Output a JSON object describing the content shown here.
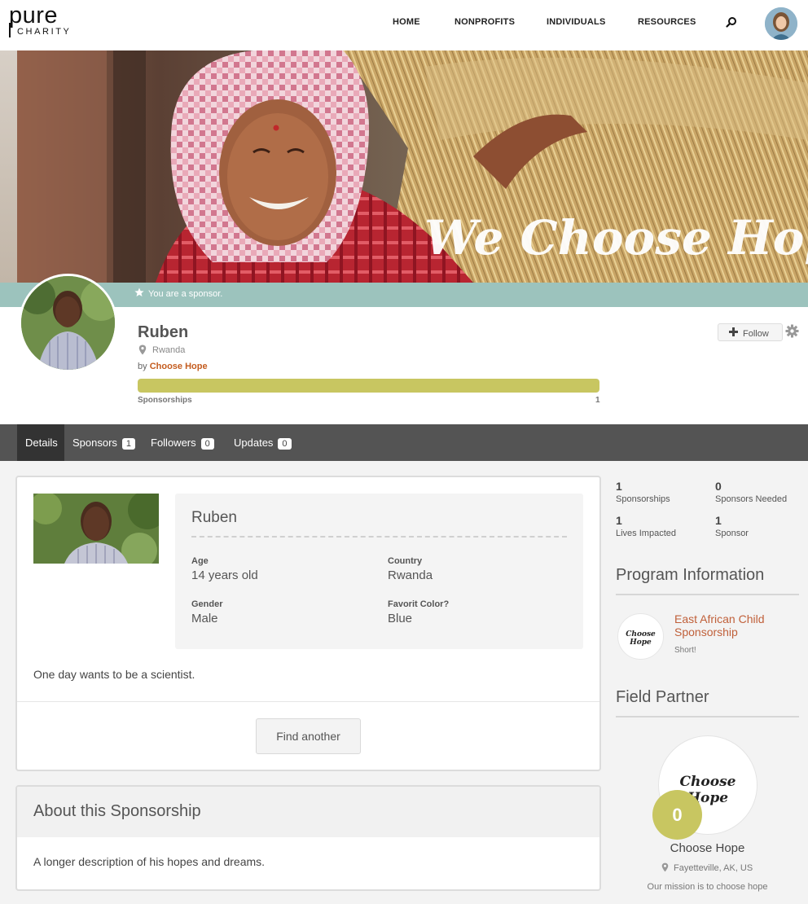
{
  "logo": {
    "line1": "pure",
    "line2": "CHARITY"
  },
  "nav": {
    "links": [
      "HOME",
      "NONPROFITS",
      "INDIVIDUALS",
      "RESOURCES"
    ],
    "search_icon": "search-icon",
    "avatar_icon": "user-avatar"
  },
  "banner": {
    "script_text": "We Choose Hope",
    "sponsor_message": "You are a sponsor."
  },
  "profile": {
    "name": "Ruben",
    "location": "Rwanda",
    "by_prefix": "by",
    "organization": "Choose Hope",
    "progress_fraction": 1.0,
    "progress_label": "Sponsorships",
    "progress_count": "1",
    "follow_label": "Follow"
  },
  "tabs": [
    {
      "label": "Details",
      "badge": ""
    },
    {
      "label": "Sponsors",
      "badge": "1"
    },
    {
      "label": "Followers",
      "badge": "0"
    },
    {
      "label": "Updates",
      "badge": "0"
    }
  ],
  "details": {
    "name": "Ruben",
    "fields": [
      {
        "label": "Age",
        "value": "14 years old"
      },
      {
        "label": "Country",
        "value": "Rwanda"
      },
      {
        "label": "Gender",
        "value": "Male"
      },
      {
        "label": "Favorit Color?",
        "value": "Blue"
      }
    ],
    "description": "One day wants to be a scientist.",
    "find_button": "Find another"
  },
  "about": {
    "title": "About this Sponsorship",
    "text": "A longer description of his hopes and dreams."
  },
  "stats": [
    {
      "num": "1",
      "label": "Sponsorships"
    },
    {
      "num": "0",
      "label": "Sponsors Needed"
    },
    {
      "num": "1",
      "label": "Lives Impacted"
    },
    {
      "num": "1",
      "label": "Sponsor"
    }
  ],
  "program": {
    "title": "Program Information",
    "logo_text": "Choose Hope",
    "name": "East African Child Sponsorship",
    "subtitle": "Short!"
  },
  "partner": {
    "title": "Field Partner",
    "logo_text": "Choose Hope",
    "badge": "0",
    "name": "Choose Hope",
    "location": "Fayetteville, AK, US",
    "mission": "Our mission is to choose hope"
  },
  "colors": {
    "accent_orange": "#c45c1f",
    "progress_green": "#c8c661",
    "tab_bar": "#545454",
    "sponsor_strip": "#9cc3bd"
  }
}
